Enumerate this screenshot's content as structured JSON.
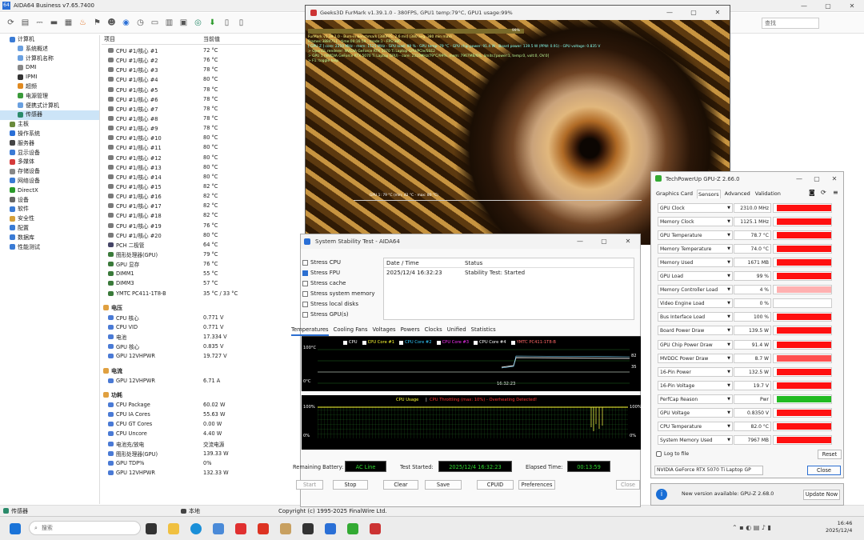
{
  "aida": {
    "title": "AIDA64 Business v7.65.7400",
    "search_placeholder": "查找",
    "tree": [
      {
        "label": "计算机",
        "level": 1,
        "color": "#3a7bd5"
      },
      {
        "label": "系统概述",
        "level": 2,
        "color": "#6aa0e0"
      },
      {
        "label": "计算机名称",
        "level": 2,
        "color": "#6aa0e0"
      },
      {
        "label": "DMI",
        "level": 2,
        "color": "#888"
      },
      {
        "label": "IPMI",
        "level": 2,
        "color": "#333"
      },
      {
        "label": "超频",
        "level": 2,
        "color": "#e08a20"
      },
      {
        "label": "电源管理",
        "level": 2,
        "color": "#3a9a3a"
      },
      {
        "label": "便携式计算机",
        "level": 2,
        "color": "#6aa0e0"
      },
      {
        "label": "传感器",
        "level": 2,
        "color": "#2a8a6a",
        "selected": true
      },
      {
        "label": "主板",
        "level": 1,
        "color": "#6a8a3a"
      },
      {
        "label": "操作系统",
        "level": 1,
        "color": "#2a6fd6"
      },
      {
        "label": "服务器",
        "level": 1,
        "color": "#444"
      },
      {
        "label": "显示设备",
        "level": 1,
        "color": "#3a7bd5"
      },
      {
        "label": "多媒体",
        "level": 1,
        "color": "#d53a3a"
      },
      {
        "label": "存储设备",
        "level": 1,
        "color": "#888"
      },
      {
        "label": "网络设备",
        "level": 1,
        "color": "#3a7bd5"
      },
      {
        "label": "DirectX",
        "level": 1,
        "color": "#2a9a2a"
      },
      {
        "label": "设备",
        "level": 1,
        "color": "#666"
      },
      {
        "label": "软件",
        "level": 1,
        "color": "#3a7bd5"
      },
      {
        "label": "安全性",
        "level": 1,
        "color": "#d5a03a"
      },
      {
        "label": "配置",
        "level": 1,
        "color": "#3a7bd5"
      },
      {
        "label": "数据库",
        "level": 1,
        "color": "#3a7bd5"
      },
      {
        "label": "性能测试",
        "level": 1,
        "color": "#3a7bd5"
      }
    ],
    "col_item": "项目",
    "col_value": "当前值",
    "rows": [
      [
        "CPU #1/核心 #1",
        "72 °C"
      ],
      [
        "CPU #1/核心 #2",
        "76 °C"
      ],
      [
        "CPU #1/核心 #3",
        "78 °C"
      ],
      [
        "CPU #1/核心 #4",
        "80 °C"
      ],
      [
        "CPU #1/核心 #5",
        "78 °C"
      ],
      [
        "CPU #1/核心 #6",
        "78 °C"
      ],
      [
        "CPU #1/核心 #7",
        "78 °C"
      ],
      [
        "CPU #1/核心 #8",
        "78 °C"
      ],
      [
        "CPU #1/核心 #9",
        "78 °C"
      ],
      [
        "CPU #1/核心 #10",
        "80 °C"
      ],
      [
        "CPU #1/核心 #11",
        "80 °C"
      ],
      [
        "CPU #1/核心 #12",
        "80 °C"
      ],
      [
        "CPU #1/核心 #13",
        "80 °C"
      ],
      [
        "CPU #1/核心 #14",
        "80 °C"
      ],
      [
        "CPU #1/核心 #15",
        "82 °C"
      ],
      [
        "CPU #1/核心 #16",
        "82 °C"
      ],
      [
        "CPU #1/核心 #17",
        "82 °C"
      ],
      [
        "CPU #1/核心 #18",
        "82 °C"
      ],
      [
        "CPU #1/核心 #19",
        "76 °C"
      ],
      [
        "CPU #1/核心 #20",
        "80 °C"
      ],
      [
        "PCH 二极管",
        "64 °C"
      ],
      [
        "图形处理器(GPU)",
        "79 °C"
      ],
      [
        "GPU 显存",
        "76 °C"
      ],
      [
        "DIMM1",
        "55 °C"
      ],
      [
        "DIMM3",
        "57 °C"
      ],
      [
        "YMTC PC411-1T8-B",
        "35 °C / 33 °C"
      ]
    ],
    "sec_voltage": "电压",
    "volt": [
      [
        "CPU 核心",
        "0.771 V"
      ],
      [
        "CPU VID",
        "0.771 V"
      ],
      [
        "电池",
        "17.334 V"
      ],
      [
        "GPU 核心",
        "0.835 V"
      ],
      [
        "GPU 12VHPWR",
        "19.727 V"
      ]
    ],
    "sec_current": "电流",
    "curr": [
      [
        "GPU 12VHPWR",
        "6.71 A"
      ]
    ],
    "sec_power": "功耗",
    "power": [
      [
        "CPU Package",
        "60.02 W"
      ],
      [
        "CPU IA Cores",
        "55.63 W"
      ],
      [
        "CPU GT Cores",
        "0.00 W"
      ],
      [
        "CPU Uncore",
        "4.40 W"
      ],
      [
        "电池充/放电",
        "交流电源"
      ],
      [
        "图形处理器(GPU)",
        "139.33 W"
      ],
      [
        "GPU TDP%",
        "0%"
      ],
      [
        "GPU 12VHPWR",
        "132.33 W"
      ]
    ],
    "status_left": "传感器",
    "status_mid": "本地",
    "status_copy": "Copyright (c) 1995-2025 FinalWire Ltd."
  },
  "furmark": {
    "title": "Geeks3D FurMark v1.39.1.0 - 380FPS, GPU1 temp:79°C, GPU1 usage:99%",
    "bar_pct": "99%",
    "lines": [
      "FurMark v1.39.1.0 - Burn-in benchmark [380FPS, 2.6 ms] (380 avg, 380 min max)",
      "Frames:3884711 - time:00:16:59 - mode:1 - FPS:380",
      "[ GPU-Z ] core: 2310 MHz - mem: 1125 MHz - GPU load: 99 % - GPU temp: 79 °C - GPU chip power: 91.4 W - Board power: 139.5 W (PPW: 0.91) - GPU voltage: 0.835 V",
      "> OpenGL renderer: NVIDIA GeForce RTX 5070 Ti Laptop GPU/PCIe/SSE2",
      "> GPU 1 (NVIDIA GeForce RTX 5070 Ti Laptop GPU) - core: 2310MHz/79°C/99%, mem: 7967MB/6%, limits:[power:1, temp:0, volt:0, OV:0]",
      "> F1: toggle help"
    ],
    "mid_text": "GPU 1: 79 °C (min: 42 °C - max: 80 °C)"
  },
  "sst": {
    "title": "System Stability Test - AIDA64",
    "checks": [
      {
        "label": "Stress CPU",
        "on": false
      },
      {
        "label": "Stress FPU",
        "on": true
      },
      {
        "label": "Stress cache",
        "on": false
      },
      {
        "label": "Stress system memory",
        "on": false
      },
      {
        "label": "Stress local disks",
        "on": false
      },
      {
        "label": "Stress GPU(s)",
        "on": false
      }
    ],
    "col_date": "Date / Time",
    "col_status": "Status",
    "date": "2025/12/4 16:32:23",
    "status": "Stability Test: Started",
    "tabs": [
      "Temperatures",
      "Cooling Fans",
      "Voltages",
      "Powers",
      "Clocks",
      "Unified",
      "Statistics"
    ],
    "legend": [
      "CPU",
      "CPU Core #1",
      "CPU Core #2",
      "CPU Core #3",
      "CPU Core #4",
      "YMTC PC411-1T8-B"
    ],
    "legend_colors": [
      "#ffffff",
      "#ffff33",
      "#33ccff",
      "#ff33ff",
      "#ffffff",
      "#ff6666"
    ],
    "g1_top": "100°C",
    "g1_bot": "0°C",
    "g1_time": "16:32:23",
    "g1_r1": "82",
    "g1_r2": "35",
    "g2_title": "CPU Usage",
    "g2_sep": "|",
    "g2_thr": "CPU Throttling (max: 10%) - Overheating Detected!",
    "g2_top": "100%",
    "g2_bot": "0%",
    "g2_rtop": "100%",
    "g2_rbot": "0%",
    "batt_label": "Remaining Battery:",
    "batt_value": "AC Line",
    "started_label": "Test Started:",
    "started_value": "2025/12/4 16:32:23",
    "elapsed_label": "Elapsed Time:",
    "elapsed_value": "00:13:59",
    "btn_start": "Start",
    "btn_stop": "Stop",
    "btn_clear": "Clear",
    "btn_save": "Save",
    "btn_cpuid": "CPUID",
    "btn_pref": "Preferences",
    "btn_close": "Close"
  },
  "gpuz": {
    "title": "TechPowerUp GPU-Z 2.66.0",
    "tabs": [
      "Graphics Card",
      "Sensors",
      "Advanced",
      "Validation"
    ],
    "sensors": [
      {
        "name": "GPU Clock",
        "value": "2310.0 MHz",
        "fill": 0.95,
        "color": "#ff1010"
      },
      {
        "name": "Memory Clock",
        "value": "1125.1 MHz",
        "fill": 0.95,
        "color": "#ff1010"
      },
      {
        "name": "GPU Temperature",
        "value": "78.7 °C",
        "fill": 0.95,
        "color": "#ff1010"
      },
      {
        "name": "Memory Temperature",
        "value": "74.0 °C",
        "fill": 0.95,
        "color": "#ff1010"
      },
      {
        "name": "Memory Used",
        "value": "1671 MB",
        "fill": 0.95,
        "color": "#ff1010"
      },
      {
        "name": "GPU Load",
        "value": "99 %",
        "fill": 0.95,
        "color": "#ff1010"
      },
      {
        "name": "Memory Controller Load",
        "value": "4 %",
        "fill": 0.95,
        "color": "#ffb0b0"
      },
      {
        "name": "Video Engine Load",
        "value": "0 %",
        "fill": 0.0,
        "color": "#ff1010"
      },
      {
        "name": "Bus Interface Load",
        "value": "100 %",
        "fill": 0.95,
        "color": "#ff1010"
      },
      {
        "name": "Board Power Draw",
        "value": "139.5 W",
        "fill": 0.95,
        "color": "#ff1010"
      },
      {
        "name": "GPU Chip Power Draw",
        "value": "91.4 W",
        "fill": 0.95,
        "color": "#ff1010"
      },
      {
        "name": "MVDDC Power Draw",
        "value": "8.7 W",
        "fill": 0.95,
        "color": "#ff5050"
      },
      {
        "name": "16-Pin Power",
        "value": "132.5 W",
        "fill": 0.95,
        "color": "#ff1010"
      },
      {
        "name": "16-Pin Voltage",
        "value": "19.7 V",
        "fill": 0.95,
        "color": "#ff1010"
      },
      {
        "name": "PerfCap Reason",
        "value": "Pwr",
        "fill": 0.95,
        "color": "#22bb22"
      },
      {
        "name": "GPU Voltage",
        "value": "0.8350 V",
        "fill": 0.95,
        "color": "#ff1010"
      },
      {
        "name": "CPU Temperature",
        "value": "82.0 °C",
        "fill": 0.95,
        "color": "#ff1010"
      },
      {
        "name": "System Memory Used",
        "value": "7967 MB",
        "fill": 0.95,
        "color": "#ff1010"
      }
    ],
    "log_label": "Log to file",
    "reset": "Reset",
    "gpu_name": "NVIDIA GeForce RTX 5070 Ti Laptop GP",
    "close": "Close",
    "notice": "New version available: GPU-Z 2.68.0",
    "update": "Update Now"
  },
  "taskbar": {
    "search": "搜索",
    "time": "16:46",
    "date": "2025/12/4",
    "start_color": "#1a73d8"
  }
}
